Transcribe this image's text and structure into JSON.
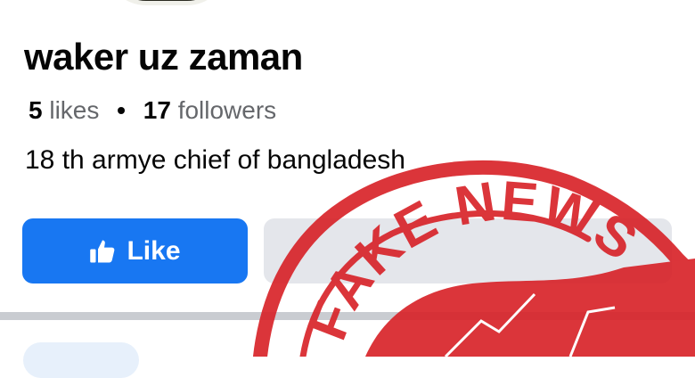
{
  "profile": {
    "name": "waker uz zaman",
    "likes_count": "5",
    "likes_label": "likes",
    "separator": "•",
    "followers_count": "17",
    "followers_label": "followers",
    "bio": "18 th armye chief of bangladesh"
  },
  "actions": {
    "like_label": "Like",
    "like_icon": "thumbs-up-icon"
  },
  "overlay": {
    "stamp_text": "FAKE NEWS",
    "stamp_color": "#d8242a"
  },
  "colors": {
    "primary_button": "#1877f2",
    "secondary_button": "#e4e6eb",
    "muted_text": "#65676b",
    "divider": "#c9ccd1"
  }
}
